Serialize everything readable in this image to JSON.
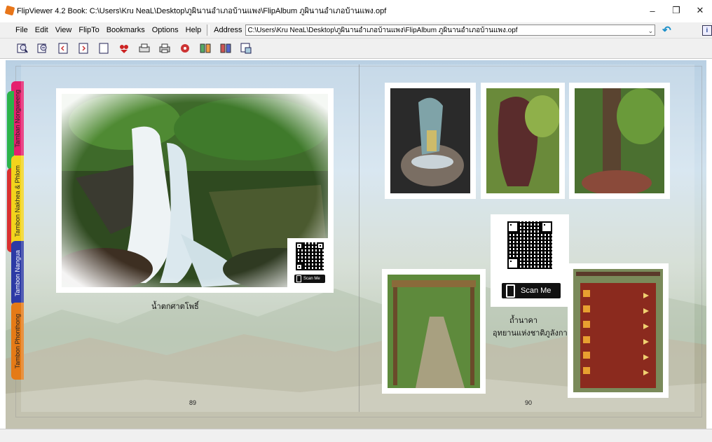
{
  "window": {
    "title": "FlipViewer 4.2   Book: C:\\Users\\Kru NeaL\\Desktop\\ภูผินานอำเภอบ้านแพง\\FlipAlbum ภูผินานอำเภอบ้านแพง.opf",
    "minimize": "–",
    "maximize": "❐",
    "close": "✕"
  },
  "menu": {
    "items": [
      "File",
      "Edit",
      "View",
      "FlipTo",
      "Bookmarks",
      "Options",
      "Help"
    ],
    "address_label": "Address",
    "address_value": "C:\\Users\\Kru NeaL\\Desktop\\ภูผินานอำเภอบ้านแพง\\FlipAlbum ภูผินานอำเภอบ้านแพง.opf",
    "info_label": "i"
  },
  "toolbar": {
    "icons": [
      "zoom-in-icon",
      "zoom-out-icon",
      "prev-page-icon",
      "next-page-icon",
      "blank-page-icon",
      "bookmark-icon",
      "print-setup-icon",
      "print-icon",
      "media-icon",
      "contents-icon",
      "index-icon",
      "help-icon"
    ]
  },
  "tabs": [
    {
      "label": "Tamban Nongweeng",
      "color": "#e5206e"
    },
    {
      "label": "Tambon Nakhea & Phlom",
      "color": "#f2d41c"
    },
    {
      "label": "Tambon Nangua",
      "color": "#2c3aa5"
    },
    {
      "label": "Tambon Phonthong",
      "color": "#e57a16"
    }
  ],
  "left_page": {
    "caption": "น้ำตกศาตโพธิ์",
    "page_number": "89",
    "qr_label": "Scan Me"
  },
  "right_page": {
    "caption_line1": "ถ้ำนาคา",
    "caption_line2": "อุทยานแห่งชาติภูลังกา",
    "page_number": "90",
    "qr_label": "Scan Me"
  },
  "colors": {
    "chrome": "#f0f0f0",
    "accent_blue": "#1a8fc9"
  }
}
